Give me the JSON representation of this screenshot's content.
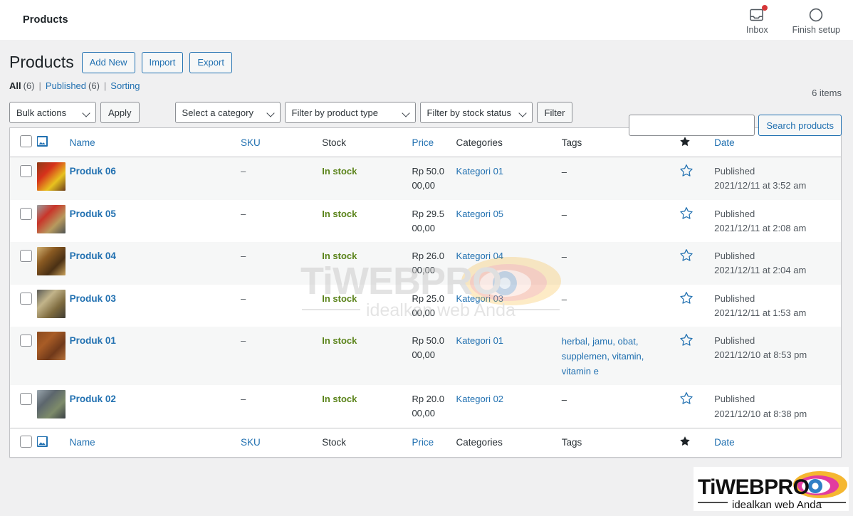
{
  "adminbar": {
    "site_title": "Products",
    "items": [
      {
        "label": "Inbox",
        "icon": "inbox-icon",
        "badge": true
      },
      {
        "label": "Finish setup",
        "icon": "progress-circle-icon",
        "badge": false
      }
    ]
  },
  "page": {
    "title": "Products",
    "actions": [
      {
        "label": "Add New",
        "name": "add-new-button"
      },
      {
        "label": "Import",
        "name": "import-button"
      },
      {
        "label": "Export",
        "name": "export-button"
      }
    ],
    "status_links": [
      {
        "label": "All",
        "count": "(6)",
        "current": true
      },
      {
        "label": "Published",
        "count": "(6)",
        "current": false
      },
      {
        "label": "Sorting",
        "count": "",
        "current": false
      }
    ],
    "separator": "|"
  },
  "search": {
    "value": "",
    "placeholder": "",
    "button_label": "Search products"
  },
  "tablenav": {
    "bulk_actions_label": "Bulk actions",
    "apply_label": "Apply",
    "category_label": "Select a category",
    "product_type_label": "Filter by product type",
    "stock_status_label": "Filter by stock status",
    "filter_label": "Filter",
    "displaying_num": "6 items"
  },
  "table": {
    "columns": [
      {
        "key": "cb",
        "label": "",
        "sortable": false,
        "name": "select-all-checkbox"
      },
      {
        "key": "thumb",
        "label": "",
        "sortable": false,
        "name": "image-column-header"
      },
      {
        "key": "name",
        "label": "Name",
        "sortable": true,
        "name": "column-header-name"
      },
      {
        "key": "sku",
        "label": "SKU",
        "sortable": true,
        "name": "column-header-sku"
      },
      {
        "key": "stock",
        "label": "Stock",
        "sortable": false,
        "name": "column-header-stock"
      },
      {
        "key": "price",
        "label": "Price",
        "sortable": true,
        "name": "column-header-price"
      },
      {
        "key": "cat",
        "label": "Categories",
        "sortable": false,
        "name": "column-header-categories"
      },
      {
        "key": "tags",
        "label": "Tags",
        "sortable": false,
        "name": "column-header-tags"
      },
      {
        "key": "star",
        "label": "",
        "sortable": false,
        "name": "column-header-featured"
      },
      {
        "key": "date",
        "label": "Date",
        "sortable": true,
        "name": "column-header-date"
      }
    ],
    "rows": [
      {
        "name": "Produk 06",
        "sku": "–",
        "stock": "In stock",
        "price": "Rp 50.000,00",
        "categories": "Kategori 01",
        "tags": "–",
        "featured": false,
        "status": "Published",
        "date": "2021/12/11 at 3:52 am",
        "thumb_colors": [
          "#8d3a16",
          "#d6321b",
          "#e8c21f",
          "#6b3d1c"
        ]
      },
      {
        "name": "Produk 05",
        "sku": "–",
        "stock": "In stock",
        "price": "Rp 29.500,00",
        "categories": "Kategori 05",
        "tags": "–",
        "featured": false,
        "status": "Published",
        "date": "2021/12/11 at 2:08 am",
        "thumb_colors": [
          "#9aa0a0",
          "#c9352a",
          "#b79a5e",
          "#4e5252"
        ]
      },
      {
        "name": "Produk 04",
        "sku": "–",
        "stock": "In stock",
        "price": "Rp 26.000,00",
        "categories": "Kategori 04",
        "tags": "–",
        "featured": false,
        "status": "Published",
        "date": "2021/12/11 at 2:04 am",
        "thumb_colors": [
          "#d2b274",
          "#8a5a22",
          "#4a3014",
          "#c9a15a"
        ]
      },
      {
        "name": "Produk 03",
        "sku": "–",
        "stock": "In stock",
        "price": "Rp 25.000,00",
        "categories": "Kategori 03",
        "tags": "–",
        "featured": false,
        "status": "Published",
        "date": "2021/12/11 at 1:53 am",
        "thumb_colors": [
          "#5b5b56",
          "#c2b48a",
          "#7d6a3e",
          "#3f3b33"
        ]
      },
      {
        "name": "Produk 01",
        "sku": "–",
        "stock": "In stock",
        "price": "Rp 50.000,00",
        "categories": "Kategori 01",
        "tags": "herbal, jamu, obat, supplemen, vitamin, vitamin e",
        "featured": false,
        "status": "Published",
        "date": "2021/12/10 at 8:53 pm",
        "thumb_colors": [
          "#8b4a1e",
          "#a85c26",
          "#70391a",
          "#b5713a"
        ]
      },
      {
        "name": "Produk 02",
        "sku": "–",
        "stock": "In stock",
        "price": "Rp 20.000,00",
        "categories": "Kategori 02",
        "tags": "–",
        "featured": false,
        "status": "Published",
        "date": "2021/12/10 at 8:38 pm",
        "thumb_colors": [
          "#9aa6ae",
          "#5c666d",
          "#7d8b6a",
          "#3a4045"
        ]
      }
    ]
  },
  "watermark": {
    "brand": "TiWEBPRO",
    "tagline": "idealkan web Anda"
  },
  "colors": {
    "link": "#2271b1",
    "in_stock": "#5b841b",
    "badge": "#d63638",
    "page_bg": "#f0f0f1",
    "row_alt": "#f6f7f7",
    "border": "#c3c4c7"
  }
}
